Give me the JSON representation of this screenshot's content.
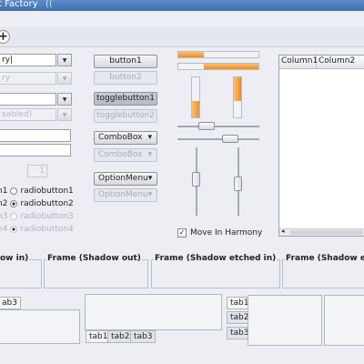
{
  "window": {
    "title": "t Factory",
    "title_suffix": "(("
  },
  "toolbar": {
    "add_label": "+"
  },
  "entries": {
    "entry1": "ry|",
    "entry2": "ry",
    "entry3": "",
    "entry4": "sabled)",
    "entry5": "",
    "entry6": ""
  },
  "spin": {
    "value": "1"
  },
  "radios": {
    "left": [
      "n1",
      "n2",
      "n3",
      "n4"
    ],
    "right": [
      "radiobutton1",
      "radiobutton2",
      "radiobutton3",
      "radiobutton4"
    ]
  },
  "buttons": {
    "button1": "button1",
    "button2": "button2",
    "toggle1": "togglebutton1",
    "toggle2": "togglebutton2"
  },
  "combos": {
    "combo1": "ComboBox",
    "combo2": "ComboBox",
    "option1": "OptionMenu",
    "option2": "OptionMenu"
  },
  "harmony": {
    "label": "Move In Harmony",
    "checked": true
  },
  "progress": {
    "h1": 0.32,
    "h2": 0.68,
    "v1": 0.4,
    "v2": 0.6,
    "v3": 0.45,
    "v4": 0.55
  },
  "tree": {
    "columns": [
      "Column1",
      "Column2"
    ]
  },
  "frames": [
    "ow in)",
    "Frame (Shadow out)",
    "Frame (Shadow etched in)",
    "Frame (Shadow etch"
  ],
  "tabs": {
    "left": [
      "ab3"
    ],
    "bottom": [
      "tab1",
      "tab2",
      "tab3"
    ],
    "side": [
      "tab1",
      "tab2",
      "tab3"
    ]
  }
}
